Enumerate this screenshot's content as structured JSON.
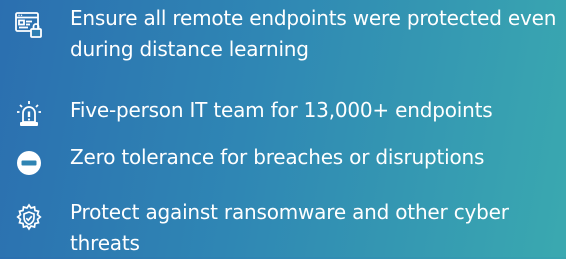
{
  "items": [
    {
      "icon": "browser-lock-icon",
      "text": "Ensure all remote endpoints were protected even during distance learning"
    },
    {
      "icon": "alert-beacon-icon",
      "text": "Five-person IT team for 13,000+ endpoints"
    },
    {
      "icon": "no-entry-icon",
      "text": "Zero tolerance for breaches or disruptions"
    },
    {
      "icon": "gear-shield-icon",
      "text": "Protect against ransomware and other cyber threats"
    }
  ],
  "colors": {
    "text": "#ffffff",
    "gradient_start": "#2b6fb0",
    "gradient_end": "#3aa9b0"
  }
}
